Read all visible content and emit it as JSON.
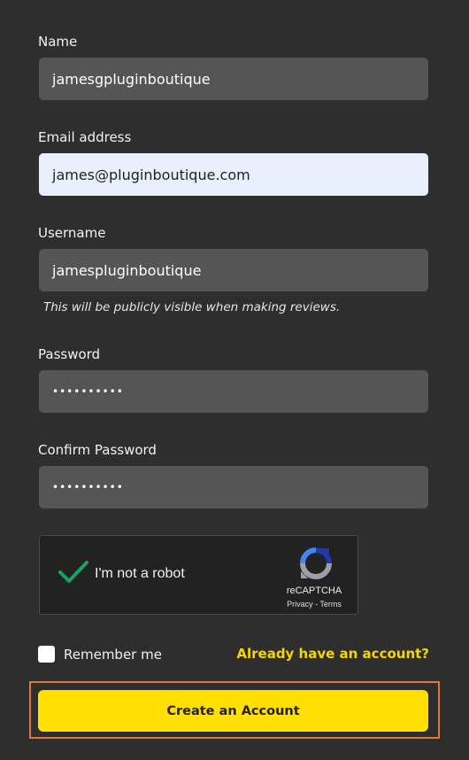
{
  "form": {
    "name": {
      "label": "Name",
      "value": "jamesgpluginboutique"
    },
    "email": {
      "label": "Email address",
      "value": "james@pluginboutique.com"
    },
    "username": {
      "label": "Username",
      "value": "jamespluginboutique",
      "hint": "This will be publicly visible when making reviews."
    },
    "password": {
      "label": "Password",
      "value": "••••••••••"
    },
    "confirm_password": {
      "label": "Confirm Password",
      "value": "••••••••••"
    }
  },
  "recaptcha": {
    "label": "I'm not a robot",
    "brand": "reCAPTCHA",
    "links": "Privacy - Terms",
    "checked": true
  },
  "remember": {
    "label": "Remember me",
    "checked": false
  },
  "login_link": "Already have an account?",
  "submit_label": "Create an Account",
  "colors": {
    "background": "#2e2e2e",
    "field": "#555555",
    "field_active": "#e8f0fe",
    "accent_yellow": "#ffe000",
    "highlight_outline": "#e27636",
    "check_green": "#1aa260"
  },
  "icons": [
    "check-icon",
    "recaptcha-logo-icon"
  ]
}
